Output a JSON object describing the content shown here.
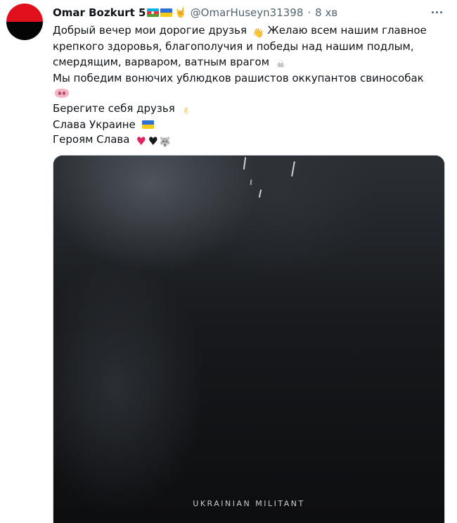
{
  "tweet": {
    "author": {
      "display_name": "Omar Bozkurt 5",
      "name_emojis": [
        "flag-azerbaijan",
        "flag-ukraine",
        "rock-on-hand"
      ],
      "handle": "@OmarHuseyn31398",
      "time": "8 хв",
      "separator": "·",
      "avatar_colors": [
        "#e0111c",
        "#050505"
      ]
    },
    "text_lines": [
      "Добрый вечер мои дорогие друзья",
      "Желаю всем нашим главное",
      "крепкого здоровья, благополучия и победы над нашим подлым,",
      "смердящим, варваром, ватным врагом",
      "Мы победим вонючих ублюдков рашистов оккупантов свиноcобак",
      "Берегите себя друзья",
      "Слава Украине",
      "Героям Слава"
    ],
    "emojis": {
      "waving_hand": "👋",
      "skull_crossbones": "☠",
      "victory_hand": "✌",
      "red_heart": "♥",
      "black_heart": "♥",
      "wolf": "🐺",
      "pig_nose": "pig-nose",
      "ukraine_flag": "flag-ukraine"
    },
    "media": {
      "watermark": "UKRAINIAN MILITANT"
    }
  },
  "accent_color": "#1d9bf0",
  "text_color": "#0f1419",
  "secondary_color": "#536471"
}
